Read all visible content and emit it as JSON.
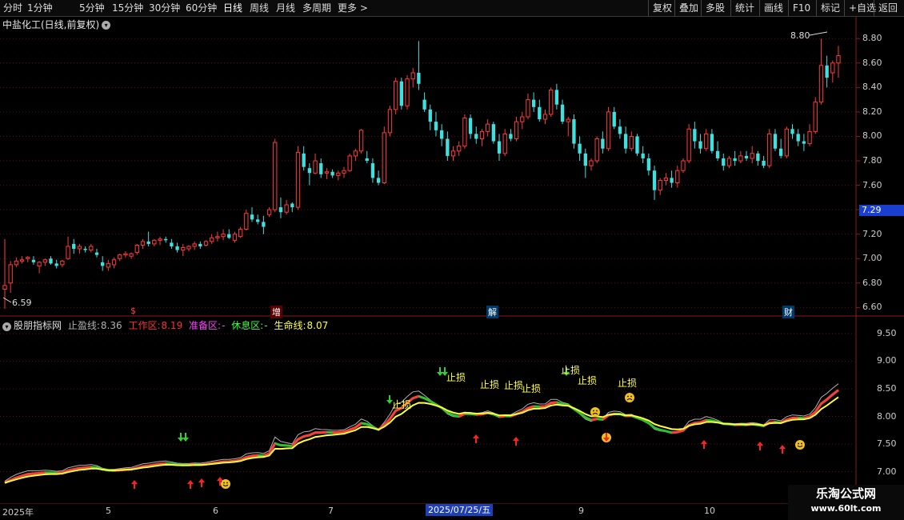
{
  "toolbar": {
    "periods": [
      "分时",
      "1分钟",
      "5分钟",
      "15分钟",
      "30分钟",
      "60分钟",
      "日线",
      "周线",
      "月线",
      "多周期",
      "更多 >"
    ],
    "active_period": "日线",
    "right_buttons": [
      "复权",
      "叠加",
      "多股",
      "统计",
      "画线",
      "F10",
      "标记",
      "+自选",
      "返回"
    ]
  },
  "main_chart": {
    "title": "中盐化工(日线,前复权)",
    "high_label": "8.80",
    "low_label": "6.59",
    "current_price": "7.29",
    "y_ticks": [
      "8.80",
      "8.60",
      "8.40",
      "8.20",
      "8.00",
      "7.80",
      "7.60",
      "7.40",
      "7.20",
      "7.00",
      "6.80",
      "6.60"
    ],
    "event_markers": [
      "$",
      "增",
      "解",
      "财"
    ]
  },
  "indicator": {
    "name": "股朋指标网",
    "fields": [
      {
        "label": "止盈线:",
        "value": "8.36",
        "color": "#b0b0b0"
      },
      {
        "label": "工作区:",
        "value": "8.19",
        "color": "#ff3030"
      },
      {
        "label": "准备区:",
        "value": "-",
        "color": "#ff40ff"
      },
      {
        "label": "休息区:",
        "value": "-",
        "color": "#40ff40"
      },
      {
        "label": "生命线:",
        "value": "8.07",
        "color": "#ffff40"
      }
    ],
    "y_ticks": [
      "9.50",
      "9.00",
      "8.50",
      "8.00",
      "7.50",
      "7.00"
    ],
    "stop_label": "止损"
  },
  "dates": {
    "labels": [
      "2025年",
      "5",
      "6",
      "7",
      "9",
      "10"
    ],
    "selected": "2025/07/25/五"
  },
  "watermark": {
    "line1": "乐淘公式网",
    "line2": "www.60lt.com"
  },
  "colors": {
    "up": "#ff3b3b",
    "down": "#3fe0e0",
    "yellow": "#ffff40",
    "green": "#30d030",
    "white": "#ffffff"
  },
  "chart_data": {
    "type": "candlestick",
    "ylim": [
      6.55,
      8.88
    ],
    "candles": [
      [
        6.75,
        7.16,
        6.59,
        6.78
      ],
      [
        6.8,
        6.98,
        6.72,
        6.95
      ],
      [
        6.95,
        7.01,
        6.93,
        6.98
      ],
      [
        6.98,
        7.02,
        6.96,
        6.99
      ],
      [
        7.0,
        7.02,
        6.97,
        7.01
      ],
      [
        6.99,
        7.02,
        6.95,
        6.97
      ],
      [
        6.94,
        6.98,
        6.88,
        6.97
      ],
      [
        6.97,
        7.0,
        6.94,
        6.99
      ],
      [
        7.0,
        7.02,
        6.95,
        6.96
      ],
      [
        6.96,
        6.99,
        6.92,
        6.94
      ],
      [
        6.95,
        6.99,
        6.93,
        6.98
      ],
      [
        7.0,
        7.18,
        6.99,
        7.1
      ],
      [
        7.12,
        7.16,
        7.04,
        7.08
      ],
      [
        7.08,
        7.12,
        7.04,
        7.1
      ],
      [
        7.08,
        7.1,
        7.05,
        7.07
      ],
      [
        7.07,
        7.12,
        7.05,
        7.1
      ],
      [
        7.05,
        7.08,
        7.01,
        7.03
      ],
      [
        6.97,
        7.02,
        6.9,
        6.94
      ],
      [
        6.93,
        6.99,
        6.9,
        6.96
      ],
      [
        6.95,
        7.01,
        6.92,
        6.99
      ],
      [
        7.0,
        7.04,
        6.98,
        7.03
      ],
      [
        7.03,
        7.06,
        7.01,
        7.04
      ],
      [
        7.02,
        7.05,
        7.0,
        7.04
      ],
      [
        7.05,
        7.12,
        7.03,
        7.11
      ],
      [
        7.11,
        7.16,
        7.08,
        7.14
      ],
      [
        7.14,
        7.22,
        7.1,
        7.12
      ],
      [
        7.12,
        7.16,
        7.1,
        7.15
      ],
      [
        7.15,
        7.18,
        7.11,
        7.16
      ],
      [
        7.16,
        7.18,
        7.13,
        7.15
      ],
      [
        7.13,
        7.16,
        7.08,
        7.1
      ],
      [
        7.1,
        7.13,
        7.05,
        7.07
      ],
      [
        7.07,
        7.12,
        7.02,
        7.09
      ],
      [
        7.08,
        7.11,
        7.06,
        7.1
      ],
      [
        7.1,
        7.14,
        7.07,
        7.12
      ],
      [
        7.12,
        7.14,
        7.08,
        7.1
      ],
      [
        7.11,
        7.15,
        7.1,
        7.14
      ],
      [
        7.14,
        7.2,
        7.12,
        7.17
      ],
      [
        7.17,
        7.22,
        7.14,
        7.18
      ],
      [
        7.18,
        7.24,
        7.15,
        7.2
      ],
      [
        7.2,
        7.24,
        7.16,
        7.17
      ],
      [
        7.15,
        7.22,
        7.13,
        7.2
      ],
      [
        7.18,
        7.26,
        7.17,
        7.24
      ],
      [
        7.24,
        7.4,
        7.23,
        7.37
      ],
      [
        7.36,
        7.42,
        7.3,
        7.32
      ],
      [
        7.32,
        7.36,
        7.28,
        7.3
      ],
      [
        7.3,
        7.35,
        7.2,
        7.26
      ],
      [
        7.36,
        7.42,
        7.34,
        7.4
      ],
      [
        7.4,
        7.98,
        7.38,
        7.95
      ],
      [
        7.42,
        7.5,
        7.33,
        7.38
      ],
      [
        7.38,
        7.48,
        7.36,
        7.44
      ],
      [
        7.45,
        7.46,
        7.38,
        7.42
      ],
      [
        7.42,
        7.92,
        7.4,
        7.87
      ],
      [
        7.86,
        7.92,
        7.72,
        7.75
      ],
      [
        7.74,
        7.78,
        7.6,
        7.7
      ],
      [
        7.7,
        7.86,
        7.69,
        7.8
      ],
      [
        7.78,
        7.82,
        7.66,
        7.69
      ],
      [
        7.7,
        7.74,
        7.65,
        7.71
      ],
      [
        7.71,
        7.73,
        7.66,
        7.68
      ],
      [
        7.68,
        7.72,
        7.64,
        7.7
      ],
      [
        7.7,
        7.75,
        7.66,
        7.72
      ],
      [
        7.72,
        7.86,
        7.71,
        7.84
      ],
      [
        7.84,
        7.9,
        7.8,
        7.88
      ],
      [
        7.88,
        8.06,
        7.86,
        8.05
      ],
      [
        7.82,
        7.88,
        7.78,
        7.8
      ],
      [
        7.78,
        7.82,
        7.62,
        7.66
      ],
      [
        7.66,
        7.72,
        7.6,
        7.62
      ],
      [
        7.62,
        8.08,
        7.61,
        8.03
      ],
      [
        8.03,
        8.25,
        8.0,
        8.22
      ],
      [
        8.22,
        8.48,
        8.18,
        8.45
      ],
      [
        8.45,
        8.48,
        8.22,
        8.25
      ],
      [
        8.25,
        8.5,
        8.22,
        8.47
      ],
      [
        8.47,
        8.56,
        8.4,
        8.52
      ],
      [
        8.52,
        8.78,
        8.38,
        8.43
      ],
      [
        8.3,
        8.36,
        8.2,
        8.22
      ],
      [
        8.22,
        8.26,
        8.05,
        8.12
      ],
      [
        8.12,
        8.2,
        8.0,
        8.05
      ],
      [
        8.05,
        8.1,
        7.92,
        7.98
      ],
      [
        7.98,
        8.04,
        7.8,
        7.84
      ],
      [
        7.84,
        7.92,
        7.8,
        7.88
      ],
      [
        7.88,
        7.96,
        7.84,
        7.92
      ],
      [
        7.92,
        8.18,
        7.9,
        8.15
      ],
      [
        8.15,
        8.18,
        7.98,
        8.02
      ],
      [
        8.02,
        8.08,
        7.94,
        7.98
      ],
      [
        7.98,
        8.06,
        7.92,
        8.04
      ],
      [
        8.04,
        8.14,
        8.0,
        8.1
      ],
      [
        8.1,
        8.12,
        7.94,
        7.96
      ],
      [
        7.96,
        8.02,
        7.8,
        7.86
      ],
      [
        7.86,
        8.06,
        7.84,
        8.02
      ],
      [
        8.02,
        8.06,
        7.96,
        7.98
      ],
      [
        7.98,
        8.16,
        7.96,
        8.12
      ],
      [
        8.12,
        8.2,
        8.06,
        8.16
      ],
      [
        8.16,
        8.35,
        8.14,
        8.3
      ],
      [
        8.3,
        8.36,
        8.2,
        8.24
      ],
      [
        8.24,
        8.3,
        8.12,
        8.14
      ],
      [
        8.14,
        8.22,
        8.1,
        8.18
      ],
      [
        8.18,
        8.4,
        8.16,
        8.38
      ],
      [
        8.38,
        8.43,
        8.22,
        8.26
      ],
      [
        8.26,
        8.3,
        8.1,
        8.12
      ],
      [
        8.12,
        8.16,
        8.0,
        8.14
      ],
      [
        8.14,
        8.18,
        7.9,
        7.94
      ],
      [
        7.94,
        8.0,
        7.8,
        7.86
      ],
      [
        7.86,
        7.9,
        7.66,
        7.76
      ],
      [
        7.76,
        7.82,
        7.72,
        7.8
      ],
      [
        7.8,
        8.0,
        7.78,
        7.98
      ],
      [
        7.98,
        8.04,
        7.86,
        7.9
      ],
      [
        7.9,
        8.24,
        7.88,
        8.2
      ],
      [
        8.2,
        8.24,
        8.06,
        8.08
      ],
      [
        8.08,
        8.14,
        7.98,
        8.02
      ],
      [
        8.02,
        8.08,
        7.86,
        7.9
      ],
      [
        7.9,
        8.04,
        7.88,
        8.0
      ],
      [
        8.0,
        8.02,
        7.84,
        7.86
      ],
      [
        7.86,
        7.92,
        7.78,
        7.82
      ],
      [
        7.82,
        7.86,
        7.68,
        7.72
      ],
      [
        7.72,
        7.76,
        7.48,
        7.56
      ],
      [
        7.56,
        7.66,
        7.52,
        7.64
      ],
      [
        7.64,
        7.7,
        7.6,
        7.66
      ],
      [
        7.66,
        7.72,
        7.58,
        7.62
      ],
      [
        7.62,
        7.76,
        7.58,
        7.72
      ],
      [
        7.72,
        7.82,
        7.7,
        7.8
      ],
      [
        7.8,
        8.1,
        7.78,
        8.06
      ],
      [
        8.06,
        8.12,
        7.9,
        7.96
      ],
      [
        7.96,
        8.02,
        7.86,
        7.9
      ],
      [
        7.9,
        8.06,
        7.88,
        8.02
      ],
      [
        8.02,
        8.06,
        7.86,
        7.88
      ],
      [
        7.88,
        7.96,
        7.8,
        7.82
      ],
      [
        7.82,
        7.86,
        7.72,
        7.76
      ],
      [
        7.76,
        7.84,
        7.74,
        7.82
      ],
      [
        7.82,
        7.88,
        7.76,
        7.8
      ],
      [
        7.8,
        7.88,
        7.78,
        7.84
      ],
      [
        7.84,
        7.88,
        7.8,
        7.82
      ],
      [
        7.82,
        7.92,
        7.78,
        7.86
      ],
      [
        7.86,
        7.88,
        7.76,
        7.8
      ],
      [
        7.8,
        7.84,
        7.74,
        7.76
      ],
      [
        7.76,
        8.06,
        7.74,
        8.02
      ],
      [
        8.02,
        8.06,
        7.88,
        7.9
      ],
      [
        7.9,
        7.98,
        7.82,
        7.84
      ],
      [
        7.84,
        8.08,
        7.82,
        8.06
      ],
      [
        8.06,
        8.1,
        7.98,
        8.02
      ],
      [
        8.02,
        8.06,
        7.92,
        7.96
      ],
      [
        7.96,
        8.02,
        7.88,
        7.94
      ],
      [
        7.94,
        8.1,
        7.92,
        8.04
      ],
      [
        8.04,
        8.32,
        8.02,
        8.28
      ],
      [
        8.28,
        8.8,
        8.26,
        8.58
      ],
      [
        8.58,
        8.66,
        8.4,
        8.48
      ],
      [
        8.52,
        8.62,
        8.44,
        8.6
      ],
      [
        8.6,
        8.74,
        8.48,
        8.66
      ]
    ]
  }
}
